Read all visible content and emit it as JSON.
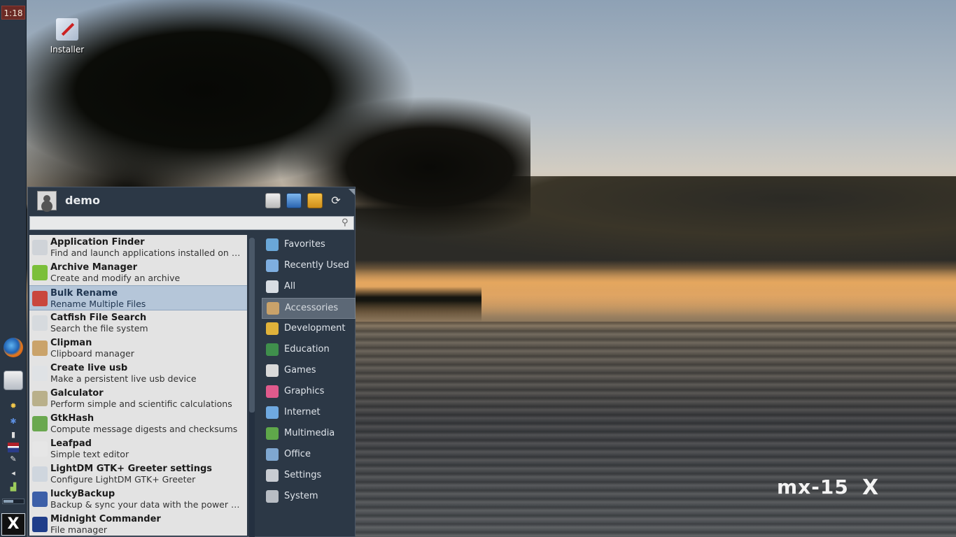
{
  "panel": {
    "clock": "1:18"
  },
  "desktop": {
    "installer_label": "Installer",
    "logo_text": "mx-15",
    "logo_mark": "X"
  },
  "menu": {
    "username": "demo",
    "search_placeholder": "",
    "applications": [
      {
        "name": "Application Finder",
        "description": "Find and launch applications installed on you...",
        "icon": "magnifier-icon",
        "color": "#cfd3d8"
      },
      {
        "name": "Archive Manager",
        "description": "Create and modify an archive",
        "icon": "archive-icon",
        "color": "#7bbf3a"
      },
      {
        "name": "Bulk Rename",
        "description": "Rename Multiple Files",
        "icon": "bulk-rename-icon",
        "color": "#c9463d",
        "selected": true
      },
      {
        "name": "Catfish File Search",
        "description": "Search the file system",
        "icon": "catfish-search-icon",
        "color": "#d6dade"
      },
      {
        "name": "Clipman",
        "description": "Clipboard manager",
        "icon": "clipboard-icon",
        "color": "#caa36a"
      },
      {
        "name": "Create live usb",
        "description": "Make a persistent live usb device",
        "icon": "usb-icon",
        "color": "#dfe2e5"
      },
      {
        "name": "Galculator",
        "description": "Perform simple and scientific calculations",
        "icon": "calculator-icon",
        "color": "#b9b08a"
      },
      {
        "name": "GtkHash",
        "description": "Compute message digests and checksums",
        "icon": "gtkhash-icon",
        "color": "#6aa84f"
      },
      {
        "name": "Leafpad",
        "description": "Simple text editor",
        "icon": "text-editor-icon",
        "color": "#e6e6e6"
      },
      {
        "name": "LightDM GTK+ Greeter settings",
        "description": "Configure LightDM GTK+ Greeter",
        "icon": "greeter-settings-icon",
        "color": "#cfd6de"
      },
      {
        "name": "luckyBackup",
        "description": "Backup & sync your data with the power of rs...",
        "icon": "backup-icon",
        "color": "#3c5fa8"
      },
      {
        "name": "Midnight Commander",
        "description": "File manager",
        "icon": "midnight-commander-icon",
        "color": "#1f3d8a"
      }
    ],
    "categories": [
      {
        "label": "Favorites",
        "icon": "favorites-icon",
        "color": "#6aa7d8"
      },
      {
        "label": "Recently Used",
        "icon": "recent-icon",
        "color": "#7eaee0"
      },
      {
        "label": "All",
        "icon": "all-apps-icon",
        "color": "#d8dde3"
      },
      {
        "label": "Accessories",
        "icon": "accessories-icon",
        "color": "#c9a26a",
        "active": true
      },
      {
        "label": "Development",
        "icon": "development-icon",
        "color": "#e0b23a"
      },
      {
        "label": "Education",
        "icon": "education-icon",
        "color": "#3f8f4c"
      },
      {
        "label": "Games",
        "icon": "games-icon",
        "color": "#d9d9d9"
      },
      {
        "label": "Graphics",
        "icon": "graphics-icon",
        "color": "#e05a8c"
      },
      {
        "label": "Internet",
        "icon": "internet-icon",
        "color": "#6fa9e0"
      },
      {
        "label": "Multimedia",
        "icon": "multimedia-icon",
        "color": "#5fa84a"
      },
      {
        "label": "Office",
        "icon": "office-icon",
        "color": "#7fa7d0"
      },
      {
        "label": "Settings",
        "icon": "settings-icon",
        "color": "#c8ccd2"
      },
      {
        "label": "System",
        "icon": "system-icon",
        "color": "#b8bdc4"
      }
    ]
  }
}
